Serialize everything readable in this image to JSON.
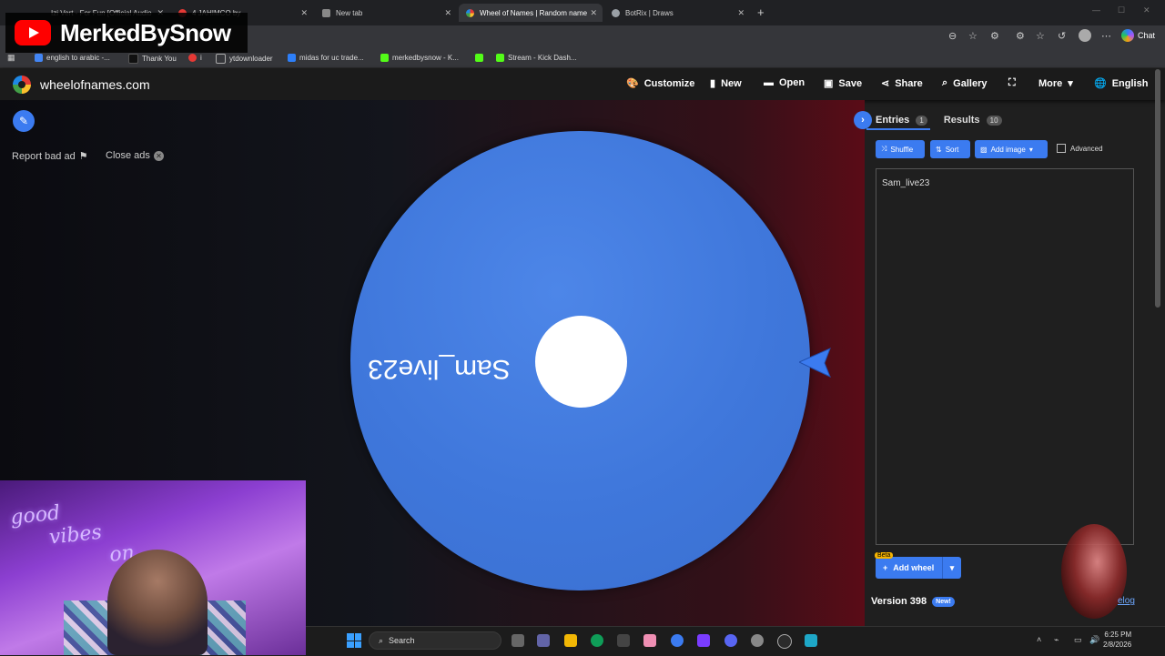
{
  "browser": {
    "tabs": [
      {
        "label": "Izi Vert - For Fun [Official Audio",
        "icon": "music-icon"
      },
      {
        "label": "4 JAHIMCO by  ",
        "icon": "bandcamp-icon"
      },
      {
        "label": "New tab",
        "icon": "page-icon"
      },
      {
        "label": "Wheel of Names | Random name",
        "icon": "wheel-icon"
      },
      {
        "label": "BotRix | Draws",
        "icon": "botrix-icon"
      }
    ],
    "new_tab": "+",
    "chat_label": "Chat",
    "bookmarks": [
      {
        "label": "english to arabic -...",
        "color": "#4285f4"
      },
      {
        "label": "Thank You",
        "color": "#111111"
      },
      {
        "label": "i",
        "color": "#e53935"
      },
      {
        "label": "ytdownloader",
        "color": "#777777"
      },
      {
        "label": "midas for uc trade...",
        "color": "#2d7ff9"
      },
      {
        "label": "merkedbysnow - K...",
        "color": "#53fc18"
      },
      {
        "label": "",
        "color": "#53fc18"
      },
      {
        "label": "Stream - Kick Dash...",
        "color": "#53fc18"
      }
    ]
  },
  "overlay": {
    "channel_name": "MerkedBySnow"
  },
  "site": {
    "title": "wheelofnames.com",
    "nav": [
      {
        "label": "Customize",
        "icon": "palette-icon"
      },
      {
        "label": "New",
        "icon": "file-icon"
      },
      {
        "label": "Open",
        "icon": "folder-icon"
      },
      {
        "label": "Save",
        "icon": "save-icon"
      },
      {
        "label": "Share",
        "icon": "share-icon"
      },
      {
        "label": "Gallery",
        "icon": "search-icon"
      },
      {
        "label": "",
        "icon": "fullscreen-icon"
      },
      {
        "label": "More",
        "icon": "chevron-down-icon"
      },
      {
        "label": "English",
        "icon": "globe-icon"
      }
    ]
  },
  "main": {
    "report_ad": "Report bad ad",
    "close_ads": "Close ads",
    "wheel_label": "Sam_live23",
    "wheel_color": "#3f77db"
  },
  "sidebar": {
    "tab_entries": "Entries",
    "entries_count": "1",
    "tab_results": "Results",
    "results_count": "10",
    "shuffle": "Shuffle",
    "sort": "Sort",
    "add_image": "Add image",
    "advanced": "Advanced",
    "entries": [
      "Sam_live23"
    ],
    "beta": "Beta",
    "add_wheel": "Add wheel",
    "version": "Version 398",
    "new_badge": "New!",
    "changelog": "elog"
  },
  "webcam": {
    "neon_line1": "good",
    "neon_line2": "vibes",
    "neon_line3": "on"
  },
  "taskbar": {
    "search_placeholder": "Search",
    "time": "6:25 PM",
    "date": "2/8/2026"
  },
  "colors": {
    "accent": "#3b7bf0",
    "wheel": "#3f77db",
    "beta": "#f5b301"
  }
}
